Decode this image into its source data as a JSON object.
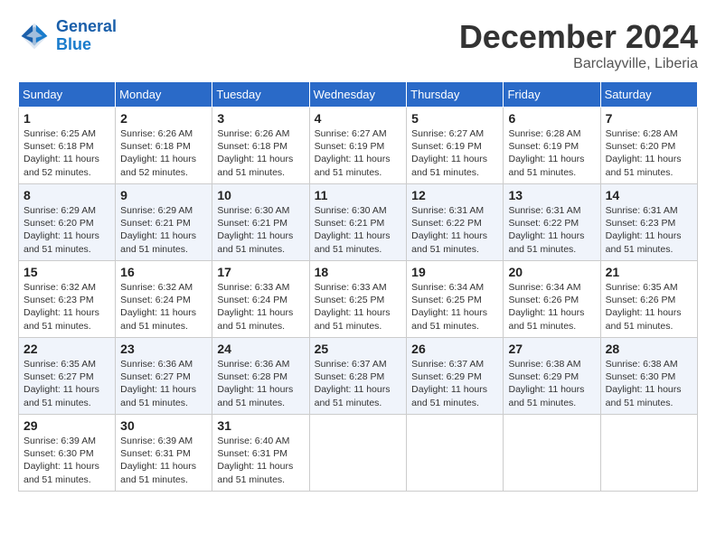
{
  "header": {
    "logo_line1": "General",
    "logo_line2": "Blue",
    "month": "December 2024",
    "location": "Barclayville, Liberia"
  },
  "weekdays": [
    "Sunday",
    "Monday",
    "Tuesday",
    "Wednesday",
    "Thursday",
    "Friday",
    "Saturday"
  ],
  "weeks": [
    [
      {
        "day": "1",
        "info": "Sunrise: 6:25 AM\nSunset: 6:18 PM\nDaylight: 11 hours\nand 52 minutes."
      },
      {
        "day": "2",
        "info": "Sunrise: 6:26 AM\nSunset: 6:18 PM\nDaylight: 11 hours\nand 52 minutes."
      },
      {
        "day": "3",
        "info": "Sunrise: 6:26 AM\nSunset: 6:18 PM\nDaylight: 11 hours\nand 51 minutes."
      },
      {
        "day": "4",
        "info": "Sunrise: 6:27 AM\nSunset: 6:19 PM\nDaylight: 11 hours\nand 51 minutes."
      },
      {
        "day": "5",
        "info": "Sunrise: 6:27 AM\nSunset: 6:19 PM\nDaylight: 11 hours\nand 51 minutes."
      },
      {
        "day": "6",
        "info": "Sunrise: 6:28 AM\nSunset: 6:19 PM\nDaylight: 11 hours\nand 51 minutes."
      },
      {
        "day": "7",
        "info": "Sunrise: 6:28 AM\nSunset: 6:20 PM\nDaylight: 11 hours\nand 51 minutes."
      }
    ],
    [
      {
        "day": "8",
        "info": "Sunrise: 6:29 AM\nSunset: 6:20 PM\nDaylight: 11 hours\nand 51 minutes."
      },
      {
        "day": "9",
        "info": "Sunrise: 6:29 AM\nSunset: 6:21 PM\nDaylight: 11 hours\nand 51 minutes."
      },
      {
        "day": "10",
        "info": "Sunrise: 6:30 AM\nSunset: 6:21 PM\nDaylight: 11 hours\nand 51 minutes."
      },
      {
        "day": "11",
        "info": "Sunrise: 6:30 AM\nSunset: 6:21 PM\nDaylight: 11 hours\nand 51 minutes."
      },
      {
        "day": "12",
        "info": "Sunrise: 6:31 AM\nSunset: 6:22 PM\nDaylight: 11 hours\nand 51 minutes."
      },
      {
        "day": "13",
        "info": "Sunrise: 6:31 AM\nSunset: 6:22 PM\nDaylight: 11 hours\nand 51 minutes."
      },
      {
        "day": "14",
        "info": "Sunrise: 6:31 AM\nSunset: 6:23 PM\nDaylight: 11 hours\nand 51 minutes."
      }
    ],
    [
      {
        "day": "15",
        "info": "Sunrise: 6:32 AM\nSunset: 6:23 PM\nDaylight: 11 hours\nand 51 minutes."
      },
      {
        "day": "16",
        "info": "Sunrise: 6:32 AM\nSunset: 6:24 PM\nDaylight: 11 hours\nand 51 minutes."
      },
      {
        "day": "17",
        "info": "Sunrise: 6:33 AM\nSunset: 6:24 PM\nDaylight: 11 hours\nand 51 minutes."
      },
      {
        "day": "18",
        "info": "Sunrise: 6:33 AM\nSunset: 6:25 PM\nDaylight: 11 hours\nand 51 minutes."
      },
      {
        "day": "19",
        "info": "Sunrise: 6:34 AM\nSunset: 6:25 PM\nDaylight: 11 hours\nand 51 minutes."
      },
      {
        "day": "20",
        "info": "Sunrise: 6:34 AM\nSunset: 6:26 PM\nDaylight: 11 hours\nand 51 minutes."
      },
      {
        "day": "21",
        "info": "Sunrise: 6:35 AM\nSunset: 6:26 PM\nDaylight: 11 hours\nand 51 minutes."
      }
    ],
    [
      {
        "day": "22",
        "info": "Sunrise: 6:35 AM\nSunset: 6:27 PM\nDaylight: 11 hours\nand 51 minutes."
      },
      {
        "day": "23",
        "info": "Sunrise: 6:36 AM\nSunset: 6:27 PM\nDaylight: 11 hours\nand 51 minutes."
      },
      {
        "day": "24",
        "info": "Sunrise: 6:36 AM\nSunset: 6:28 PM\nDaylight: 11 hours\nand 51 minutes."
      },
      {
        "day": "25",
        "info": "Sunrise: 6:37 AM\nSunset: 6:28 PM\nDaylight: 11 hours\nand 51 minutes."
      },
      {
        "day": "26",
        "info": "Sunrise: 6:37 AM\nSunset: 6:29 PM\nDaylight: 11 hours\nand 51 minutes."
      },
      {
        "day": "27",
        "info": "Sunrise: 6:38 AM\nSunset: 6:29 PM\nDaylight: 11 hours\nand 51 minutes."
      },
      {
        "day": "28",
        "info": "Sunrise: 6:38 AM\nSunset: 6:30 PM\nDaylight: 11 hours\nand 51 minutes."
      }
    ],
    [
      {
        "day": "29",
        "info": "Sunrise: 6:39 AM\nSunset: 6:30 PM\nDaylight: 11 hours\nand 51 minutes."
      },
      {
        "day": "30",
        "info": "Sunrise: 6:39 AM\nSunset: 6:31 PM\nDaylight: 11 hours\nand 51 minutes."
      },
      {
        "day": "31",
        "info": "Sunrise: 6:40 AM\nSunset: 6:31 PM\nDaylight: 11 hours\nand 51 minutes."
      },
      null,
      null,
      null,
      null
    ]
  ]
}
